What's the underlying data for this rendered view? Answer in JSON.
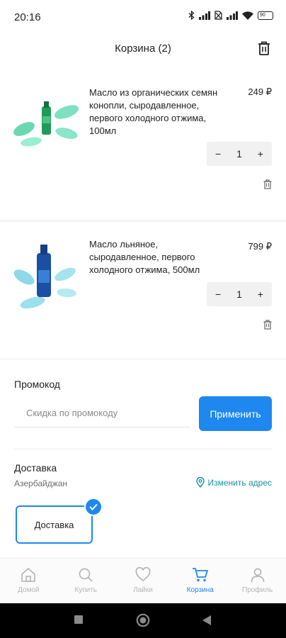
{
  "status_bar": {
    "time": "20:16",
    "battery": "90"
  },
  "header": {
    "title": "Корзина (2)"
  },
  "cart_items": [
    {
      "title": "Масло из органических семян конопли, сыродавленное, первого холодного отжима, 100мл",
      "price": "249 ₽",
      "quantity": "1"
    },
    {
      "title": "Масло льняное, сыродавленное, первого холодного отжима, 500мл",
      "price": "799 ₽",
      "quantity": "1"
    }
  ],
  "stepper": {
    "minus": "−",
    "plus": "+"
  },
  "promo": {
    "label": "Промокод",
    "placeholder": "Скидка по промокоду",
    "button": "Применить"
  },
  "delivery": {
    "label": "Доставка",
    "country": "Азербайджан",
    "change_address": "Изменить адрес",
    "option": "Доставка"
  },
  "nav": [
    {
      "label": "Домой",
      "icon": "home-icon"
    },
    {
      "label": "Купить",
      "icon": "search-icon"
    },
    {
      "label": "Лайки",
      "icon": "heart-icon"
    },
    {
      "label": "Корзина",
      "icon": "cart-icon",
      "active": true
    },
    {
      "label": "Профиль",
      "icon": "profile-icon"
    }
  ],
  "colors": {
    "accent": "#1e88f0",
    "link": "#1a8fa8",
    "inactive": "#b5b5b5"
  }
}
